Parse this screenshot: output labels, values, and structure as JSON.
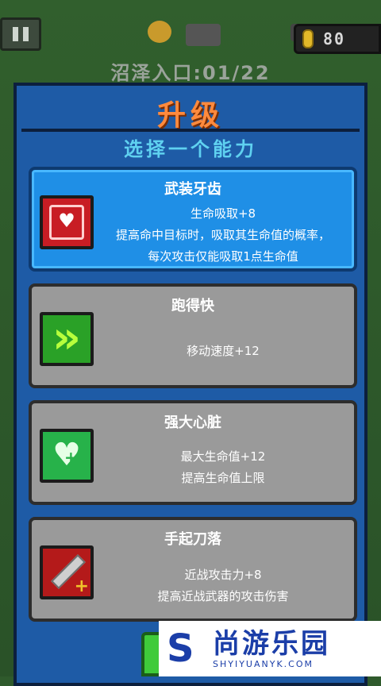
{
  "hud": {
    "coins": "80",
    "level_label": "沼泽入口:01/22"
  },
  "panel": {
    "title": "升级",
    "subtitle": "选择一个能力",
    "abilities": [
      {
        "name": "武装牙齿",
        "line1": "生命吸取+8",
        "line2": "提高命中目标时，吸取其生命值的概率，",
        "line3": "每次攻击仅能吸取1点生命值",
        "icon": "fang-heart-icon"
      },
      {
        "name": "跑得快",
        "line1": "移动速度+12",
        "icon": "speed-arrow-icon"
      },
      {
        "name": "强大心脏",
        "line1": "最大生命值+12",
        "line2": "提高生命值上限",
        "icon": "heart-plus-icon"
      },
      {
        "name": "手起刀落",
        "line1": "近战攻击力+8",
        "line2": "提高近战武器的攻击伤害",
        "icon": "sword-plus-icon"
      }
    ]
  },
  "watermark": {
    "logo": "S",
    "cn": "尚游乐园",
    "en": "SHYIYUANYK.COM"
  }
}
